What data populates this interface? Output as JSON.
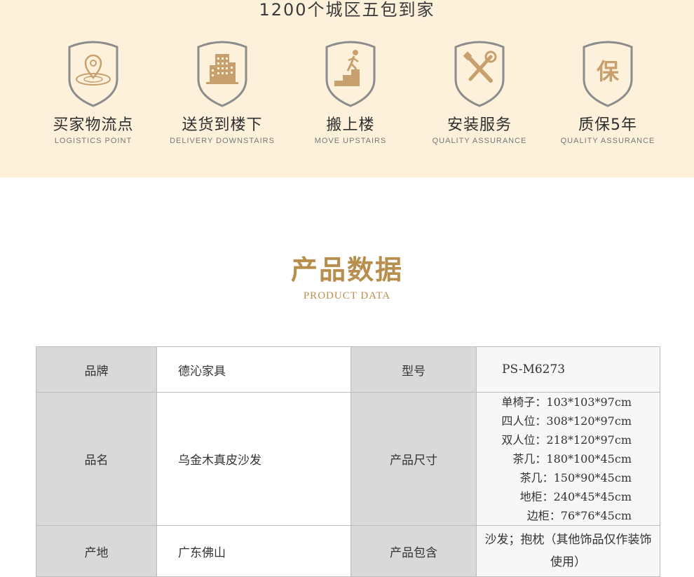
{
  "banner": {
    "headline": "1200个城区五包到家",
    "services": [
      {
        "title": "买家物流点",
        "subtitle": "LOGISTICS POINT",
        "icon": "location-pin-icon"
      },
      {
        "title": "送货到楼下",
        "subtitle": "DELIVERY DOWNSTAIRS",
        "icon": "building-icon"
      },
      {
        "title": "搬上楼",
        "subtitle": "MOVE UPSTAIRS",
        "icon": "stairs-person-icon"
      },
      {
        "title": "安装服务",
        "subtitle": "QUALITY ASSURANCE",
        "icon": "tools-icon"
      },
      {
        "title": "质保5年",
        "subtitle": "QUALITY ASSURANCE",
        "icon": "guarantee-icon",
        "glyph": "保"
      }
    ]
  },
  "section": {
    "title": "产品数据",
    "subtitle": "PRODUCT DATA"
  },
  "spec": {
    "brand_label": "品牌",
    "brand": "德沁家具",
    "model_label": "型号",
    "model": "PS-M6273",
    "name_label": "品名",
    "name": "乌金木真皮沙发",
    "size_label": "产品尺寸",
    "sizes": [
      "单椅子：103*103*97cm",
      "四人位：308*120*97cm",
      "双人位：218*120*97cm",
      "茶几：180*100*45cm",
      "茶几：150*90*45cm",
      "地柜：240*45*45cm",
      "边柜：76*76*45cm"
    ],
    "origin_label": "产地",
    "origin": "广东佛山",
    "includes_label": "产品包含",
    "includes": "沙发；抱枕（其他饰品仅作装饰使用）"
  },
  "colors": {
    "banner_bg": "#fdf1dc",
    "shield_stroke": "#8c8c8c",
    "icon_fill": "#c7a06d",
    "accent": "#b88e4d",
    "label_bg": "#d9d9d9"
  }
}
